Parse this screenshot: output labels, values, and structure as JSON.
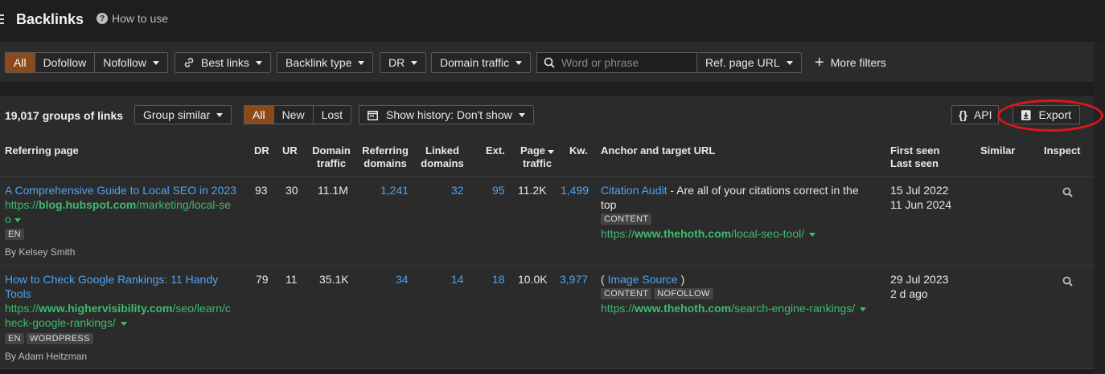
{
  "header": {
    "title": "Backlinks",
    "how_to_use": "How to use"
  },
  "filters": {
    "all": "All",
    "dofollow": "Dofollow",
    "nofollow": "Nofollow",
    "best_links": "Best links",
    "backlink_type": "Backlink type",
    "dr": "DR",
    "domain_traffic": "Domain traffic",
    "search_placeholder": "Word or phrase",
    "ref_page_url": "Ref. page URL",
    "more_filters": "More filters"
  },
  "toolbar": {
    "group_count": "19,017 groups of links",
    "group_similar": "Group similar",
    "all": "All",
    "new": "New",
    "lost": "Lost",
    "show_history": "Show history: Don't show",
    "api": "API",
    "export": "Export"
  },
  "columns": {
    "referring_page": "Referring page",
    "dr": "DR",
    "ur": "UR",
    "domain_traffic_1": "Domain",
    "domain_traffic_2": "traffic",
    "referring_domains_1": "Referring",
    "referring_domains_2": "domains",
    "linked_domains_1": "Linked",
    "linked_domains_2": "domains",
    "ext": "Ext.",
    "page_traffic_1": "Page",
    "page_traffic_2": "traffic",
    "kw": "Kw.",
    "anchor": "Anchor and target URL",
    "first_seen": "First seen",
    "last_seen": "Last seen",
    "similar": "Similar",
    "inspect": "Inspect"
  },
  "rows": [
    {
      "title": "A Comprehensive Guide to Local SEO in 2023",
      "url_prefix": "https://",
      "url_domain": "blog.hubspot.com",
      "url_path_1": "/marketing/local-se",
      "url_path_2": "o",
      "lang": "EN",
      "author": "By Kelsey Smith",
      "dr": "93",
      "ur": "30",
      "domain_traffic": "11.1M",
      "referring_domains": "1,241",
      "linked_domains": "32",
      "ext": "95",
      "page_traffic": "11.2K",
      "kw": "1,499",
      "anchor_link": "Citation Audit",
      "anchor_text_1": " - Are all of your citations correct in the",
      "anchor_text_2": "top",
      "tag_1": "CONTENT",
      "target_prefix": "https://",
      "target_domain": "www.thehoth.com",
      "target_path": "/local-seo-tool/",
      "first_seen": "15 Jul 2022",
      "last_seen": "11 Jun 2024"
    },
    {
      "title_1": "How to Check Google Rankings: 11 Handy",
      "title_2": "Tools",
      "url_prefix": "https://",
      "url_domain": "www.highervisibility.com",
      "url_path_1": "/seo/learn/c",
      "url_path_2": "heck-google-rankings/",
      "lang": "EN",
      "tag_cms": "WORDPRESS",
      "author": "By Adam Heitzman",
      "dr": "79",
      "ur": "11",
      "domain_traffic": "35.1K",
      "referring_domains": "34",
      "linked_domains": "14",
      "ext": "18",
      "page_traffic": "10.0K",
      "kw": "3,977",
      "anchor_open": "( ",
      "anchor_link": "Image Source",
      "anchor_close": " )",
      "tag_1": "CONTENT",
      "tag_2": "NOFOLLOW",
      "target_prefix": "https://",
      "target_domain": "www.thehoth.com",
      "target_path": "/search-engine-rankings/",
      "first_seen": "29 Jul 2023",
      "last_seen": "2 d ago"
    }
  ]
}
